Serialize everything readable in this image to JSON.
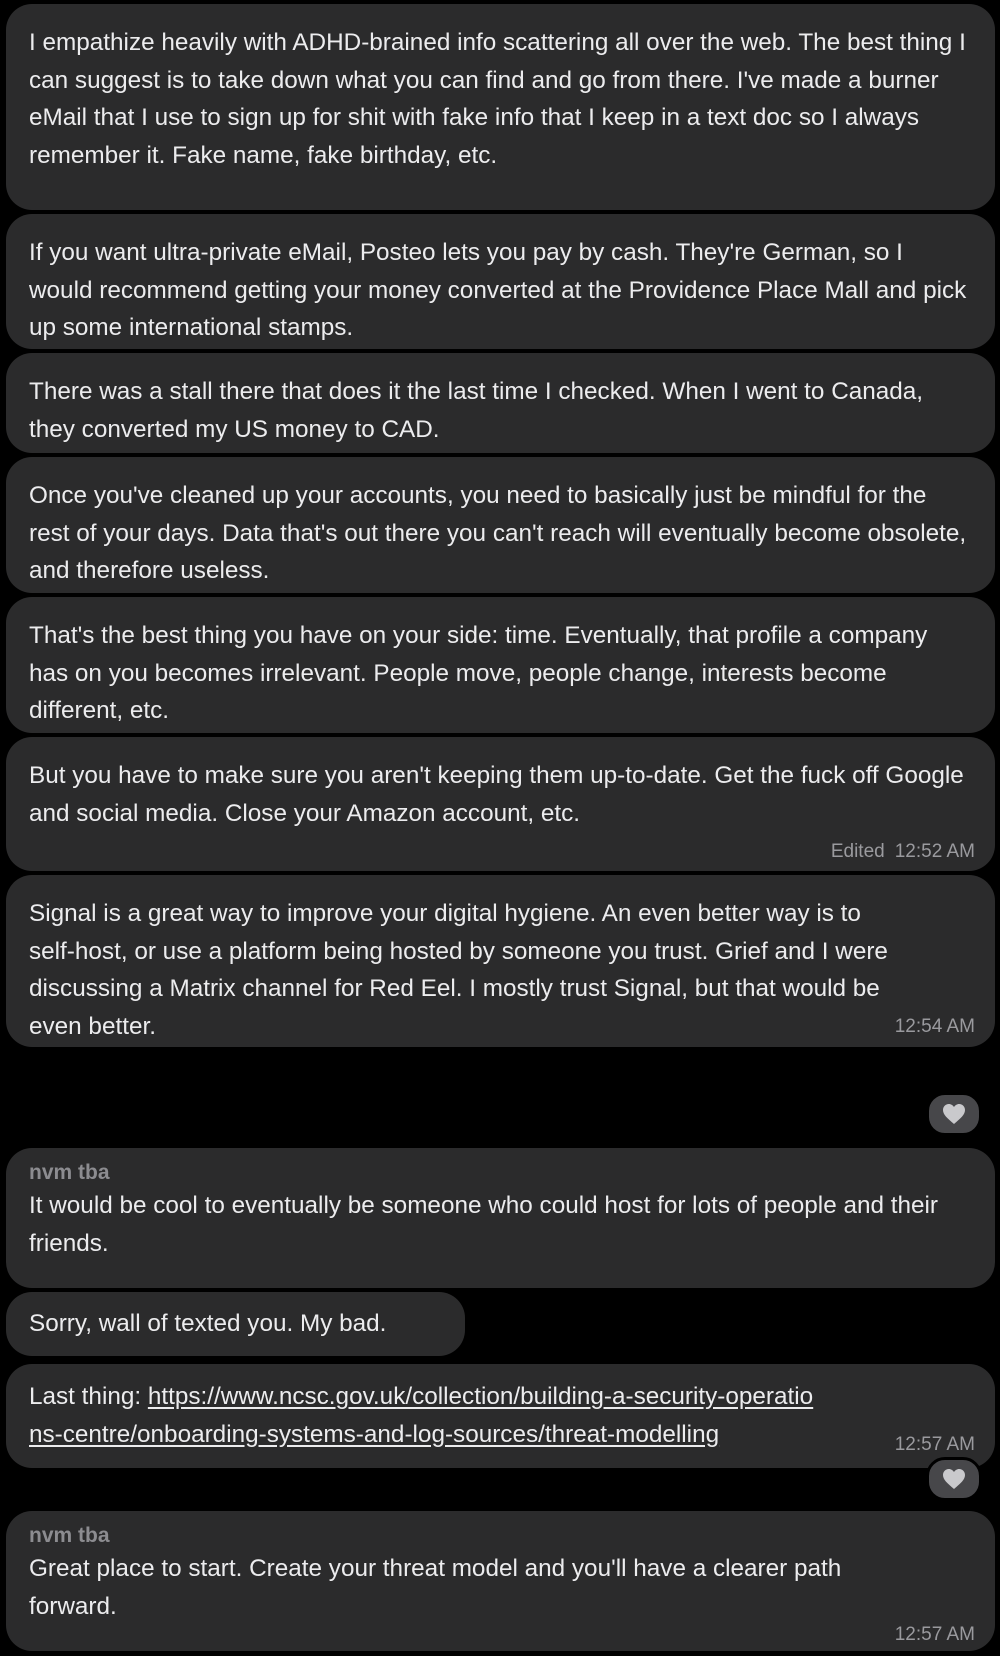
{
  "messages": [
    {
      "text": "I empathize heavily with ADHD-brained info scattering all over the web. The best thing I can suggest is to take down what you can find and go from there. I've made a burner eMail that I use to sign up for shit with fake info that I keep in a text doc so I always remember it. Fake name, fake birthday, etc."
    },
    {
      "text": "If you want ultra-private eMail, Posteo lets you pay by cash. They're German, so I would recommend getting your money converted at the Providence Place Mall and pick up some international stamps."
    },
    {
      "text": "There was a stall there that does it the last time I checked. When I went to Canada, they converted my US money to CAD."
    },
    {
      "text": "Once you've cleaned up your accounts, you need to basically just be mindful for the rest of your days. Data that's out there you can't reach will eventually become obsolete, and therefore useless."
    },
    {
      "text": "That's the best thing you have on your side: time. Eventually, that profile a company has on you becomes irrelevant. People move, people change, interests become different, etc."
    },
    {
      "text": "But you have to make sure you aren't keeping them up-to-date. Get the fuck off Google and social media. Close your Amazon account, etc.",
      "edited": "Edited",
      "time": "12:52 AM"
    },
    {
      "text": "Signal is a great way to improve your digital hygiene. An even better way is to self-host, or use a platform being hosted by someone you trust. Grief and I were discussing a Matrix channel for Red Eel. I mostly trust Signal, but that would be even better.",
      "time": "12:54 AM",
      "reaction": "heart"
    },
    {
      "sender": "nvm tba",
      "text": "It would be cool to eventually be someone who could host for lots of people and their friends."
    },
    {
      "text": "Sorry, wall of texted you. My bad."
    },
    {
      "prefix": "Last thing: ",
      "link_line1": "https://www.ncsc.gov.uk/collection/building-a-security-operatio",
      "link_line2": "ns-centre/onboarding-systems-and-log-sources/threat-modelling",
      "time": "12:57 AM",
      "reaction": "heart"
    },
    {
      "sender": "nvm tba",
      "text": "Great place to start. Create your threat model and you'll have a clearer path forward.",
      "time": "12:57 AM"
    }
  ],
  "colors": {
    "background": "#000000",
    "bubble": "#2b2b2c",
    "text": "#ececee",
    "meta": "#9a9a9e",
    "sender": "#8c8c90",
    "reaction_heart": "#c9c9cc"
  }
}
